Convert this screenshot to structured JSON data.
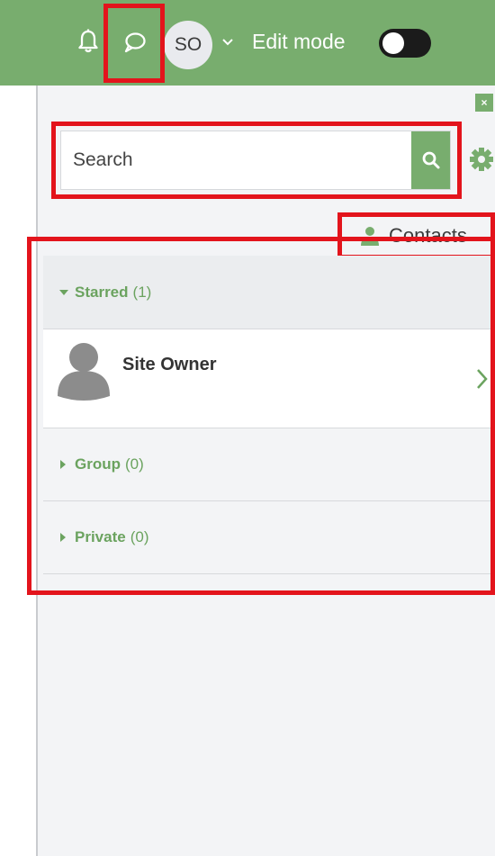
{
  "topbar": {
    "avatar_initials": "SO",
    "edit_mode_label": "Edit mode",
    "edit_mode_on": false,
    "icons": [
      "bell-icon",
      "chat-icon",
      "chevron-down-icon"
    ],
    "bg_color": "#78ad6e"
  },
  "drawer": {
    "close_label": "×",
    "search": {
      "placeholder": "Search",
      "value": ""
    },
    "contacts_label": "Contacts",
    "sections": [
      {
        "name": "Starred",
        "count": "(1)",
        "expanded": true
      },
      {
        "name": "Group",
        "count": "(0)",
        "expanded": false
      },
      {
        "name": "Private",
        "count": "(0)",
        "expanded": false
      }
    ],
    "starred_contacts": [
      {
        "name": "Site Owner"
      }
    ]
  },
  "colors": {
    "accent": "#78ad6e",
    "section_text": "#6ba35f",
    "highlight": "#e3141c"
  }
}
